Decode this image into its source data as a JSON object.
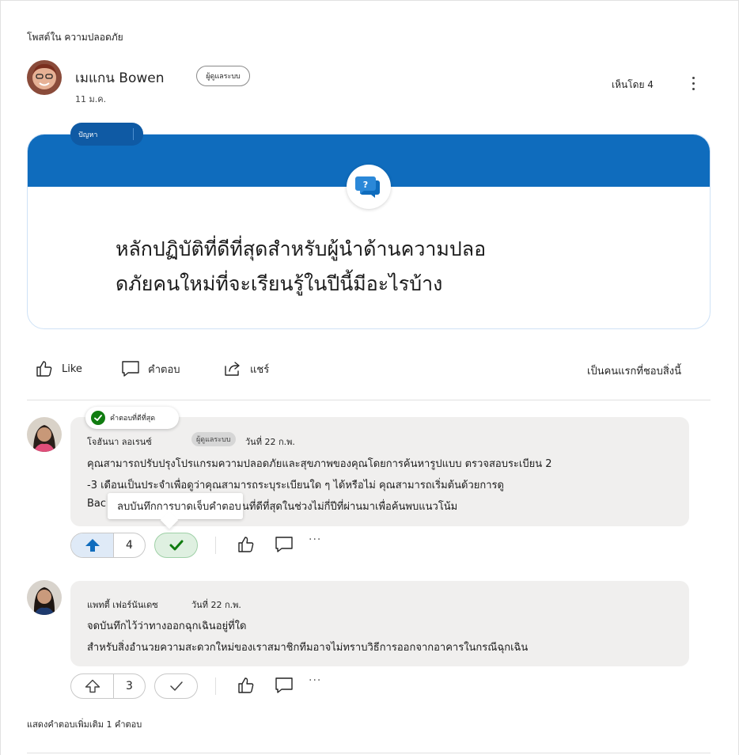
{
  "post": {
    "posted_in": "โพสต์ใน ความปลอดภัย",
    "author_name": "เมแกน Bowen",
    "author_role": "ผู้ดูแลระบบ",
    "date": "11 ม.ค.",
    "seen_by": "เห็นโดย 4",
    "tag": "ปัญหา",
    "question": "หลักปฏิบัติที่ดีที่สุดสำหรับผู้นำด้านความปลอดภัยคนใหม่ที่จะเรียนรู้ในปีนี้มีอะไรบ้าง",
    "question_lines": [
      "หลักปฏิบัติที่ดีที่สุดสำหรับผู้นำด้านความปลอ",
      "ดภัยคนใหม่ที่จะเรียนรู้ในปีนี้มีอะไรบ้าง"
    ]
  },
  "actions": {
    "like": "Like",
    "reply": "คำตอบ",
    "share": "แชร์",
    "first_like": "เป็นคนแรกที่ชอบสิ่งนี้"
  },
  "comments": [
    {
      "best_answer_label": "คำตอบที่ดีที่สุด",
      "author": "โจฮันนา ลอเรนซ์",
      "role": "ผู้ดูแลระบบ",
      "date": "วันที่ 22 ก.พ.",
      "lines": [
        "คุณสามารถปรับปรุงโปรแกรมความปลอดภัยและสุขภาพของคุณโดยการค้นหารูปแบบ ตรวจสอบระเบียน 2",
        "-3 เดือนเป็นประจำเพื่อดูว่าคุณสามารถระบุระเบียนใด ๆ ได้หรือไม่ คุณสามารถเริ่มต้นด้วยการดู",
        "Bac",
        "นที่ดีที่สุดในช่วงไม่กี่ปีที่ผ่านมาเพื่อค้นพบแนวโน้ม"
      ],
      "tooltip": "ลบบันทึกการบาดเจ็บคำตอบ",
      "votes": "4"
    },
    {
      "author": "แพทตี้ เฟอร์นันเดซ",
      "date": "วันที่ 22 ก.พ.",
      "lines": [
        "จดบันทึกไว้ว่าทางออกฉุกเฉินอยู่ที่ใด",
        "สำหรับสิ่งอำนวยความสะดวกใหม่ของเราสมาชิกทีมอาจไม่ทราบวิธีการออกจากอาคารในกรณีฉุกเฉิน"
      ],
      "votes": "3"
    }
  ],
  "show_more": "แสดงคำตอบเพิ่มเติม 1 คำตอบ",
  "colors": {
    "accent": "#0f6cbd",
    "best_answer": "#107c10",
    "bubble": "#f0efee"
  }
}
